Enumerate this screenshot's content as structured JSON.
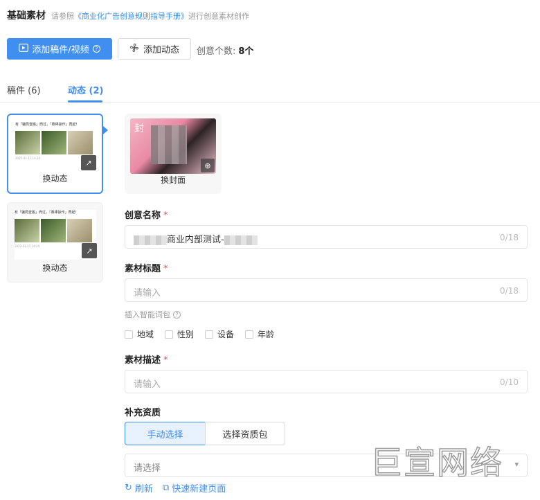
{
  "header": {
    "title": "基础素材",
    "hint_prefix": "请参照",
    "hint_link": "《商业化广告创意规则指导手册》",
    "hint_suffix": "进行创意素材创作"
  },
  "toolbar": {
    "add_manuscript_label": "添加稿件/视频",
    "add_dynamic_label": "添加动态",
    "count_label": "创意个数:",
    "count_value": "8个"
  },
  "tabs": [
    {
      "label": "稿件 (6)"
    },
    {
      "label": "动态 (2)"
    }
  ],
  "cards": [
    {
      "text": "有「骗局查搬」而过，「幕棒操作」再起!",
      "meta": "2022-01-11 14:24",
      "label": "换动态"
    },
    {
      "text": "有「骗局查搬」而过，「幕棒操作」再起!",
      "meta": "2022-01-11 14:24",
      "label": "换动态"
    }
  ],
  "cover": {
    "badge": "封",
    "label": "换封面"
  },
  "fields": {
    "name": {
      "label": "创意名称",
      "value": "商业内部测试-",
      "count": "0/18"
    },
    "title": {
      "label": "素材标题",
      "placeholder": "请输入",
      "count": "0/18"
    },
    "smart_words": "插入智能词包",
    "checkboxes": [
      "地域",
      "性别",
      "设备",
      "年龄"
    ],
    "desc": {
      "label": "素材描述",
      "placeholder": "请输入",
      "count": "0/10"
    },
    "qual": {
      "label": "补充资质",
      "manual": "手动选择",
      "package": "选择资质包",
      "select_placeholder": "请选择"
    }
  },
  "links": {
    "refresh": "刷新",
    "new_page": "快速新建页面"
  },
  "watermark": "巨宣网络"
}
